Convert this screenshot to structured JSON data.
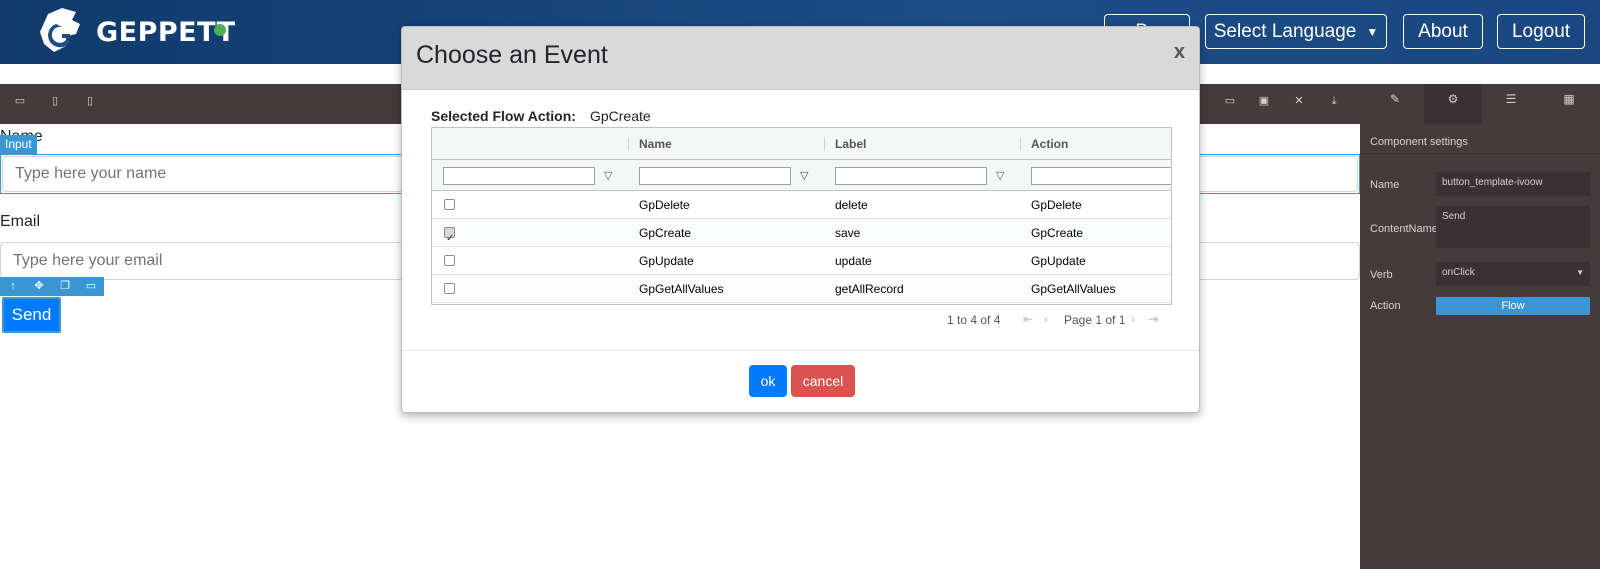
{
  "header": {
    "brand": "GEPPETT",
    "buttons": {
      "partial": "Ba",
      "select_language": "Select Language",
      "about": "About",
      "logout": "Logout"
    }
  },
  "toolbar": {
    "left_icons": [
      "desktop-icon",
      "tablet-icon",
      "mobile-icon"
    ],
    "right_icons": [
      "trash-icon",
      "save-icon",
      "close-icon",
      "download-icon"
    ]
  },
  "right_panel": {
    "tabs": [
      "brush-icon",
      "gear-icon",
      "layers-icon",
      "blocks-icon"
    ],
    "section_title": "Component settings",
    "fields": {
      "name_label": "Name",
      "name_value": "button_template-ivoow",
      "content_label": "ContentName",
      "content_value": "Send",
      "verb_label": "Verb",
      "verb_value": "onClick",
      "action_label": "Action",
      "action_value": "Flow"
    }
  },
  "canvas": {
    "name_label": "Name",
    "input_badge": "Input",
    "name_placeholder": "Type here your name",
    "email_label": "Email",
    "email_placeholder": "Type here your email",
    "send_label": "Send"
  },
  "modal": {
    "title": "Choose an Event",
    "close": "x",
    "selected_flow_label": "Selected Flow Action:",
    "selected_flow_value": "GpCreate",
    "columns": [
      "",
      "Name",
      "Label",
      "Action"
    ],
    "rows": [
      {
        "checked": false,
        "name": "GpDelete",
        "label": "delete",
        "action": "GpDelete"
      },
      {
        "checked": true,
        "name": "GpCreate",
        "label": "save",
        "action": "GpCreate"
      },
      {
        "checked": false,
        "name": "GpUpdate",
        "label": "update",
        "action": "GpUpdate"
      },
      {
        "checked": false,
        "name": "GpGetAllValues",
        "label": "getAllRecord",
        "action": "GpGetAllValues"
      }
    ],
    "pagination": {
      "summary": "1 to 4 of 4",
      "page_label": "Page 1 of 1"
    },
    "ok_label": "ok",
    "cancel_label": "cancel"
  },
  "colors": {
    "header": "#1c4c86",
    "panel": "#463a3c",
    "accent": "#3b97d3",
    "primary": "#007bff",
    "danger": "#d9534f"
  }
}
